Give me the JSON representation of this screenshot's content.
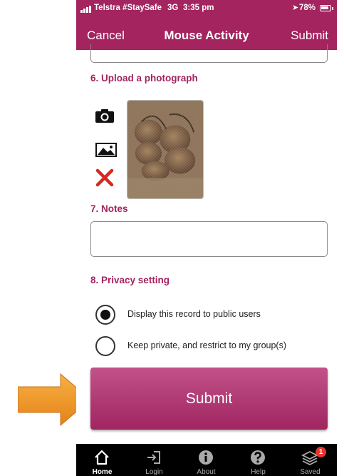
{
  "status": {
    "carrier": "Telstra #StaySafe",
    "network": "3G",
    "time": "3:35 pm",
    "battery": "78%"
  },
  "nav": {
    "cancel": "Cancel",
    "title": "Mouse Activity",
    "submit": "Submit"
  },
  "form": {
    "upload_label": "6. Upload a photograph",
    "notes_label": "7. Notes",
    "notes_value": "",
    "privacy_label": "8. Privacy setting",
    "privacy_options": [
      {
        "label": "Display this record to public users",
        "selected": true
      },
      {
        "label": "Keep private, and restrict to my group(s)",
        "selected": false
      }
    ],
    "submit_label": "Submit"
  },
  "tabs": [
    {
      "label": "Home",
      "icon": "home-icon",
      "active": true
    },
    {
      "label": "Login",
      "icon": "login-icon",
      "active": false
    },
    {
      "label": "About",
      "icon": "info-icon",
      "active": false
    },
    {
      "label": "Help",
      "icon": "help-icon",
      "active": false
    },
    {
      "label": "Saved",
      "icon": "layers-icon",
      "active": false,
      "badge": "1"
    }
  ],
  "colors": {
    "brand": "#a3245f",
    "arrow": "#f39a1f"
  }
}
